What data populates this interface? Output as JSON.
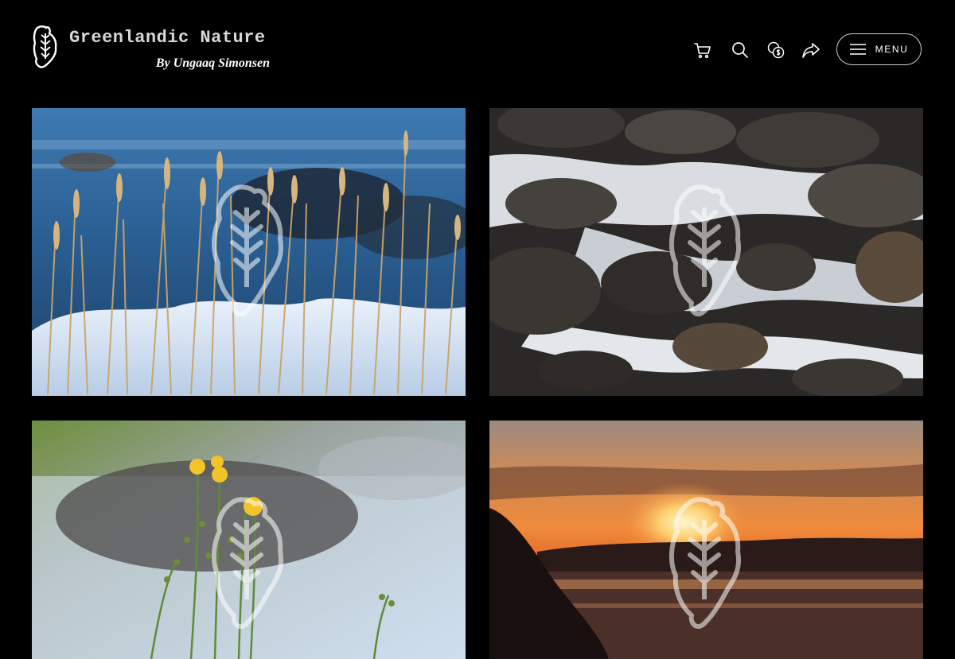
{
  "brand": {
    "title": "Greenlandic Nature",
    "subtitle": "By Ungaaq Simonsen",
    "logo_icon": "greenland-leaf-logo-icon"
  },
  "header": {
    "icons": [
      "cart-icon",
      "search-icon",
      "currency-icon",
      "share-icon"
    ],
    "menu_label": "MENU"
  },
  "gallery": {
    "photos": [
      {
        "subject": "frosted-grass-snow",
        "watermark": "greenland-leaf-watermark"
      },
      {
        "subject": "icy-rocks-stream",
        "watermark": "greenland-leaf-watermark"
      },
      {
        "subject": "yellow-wildflowers-river",
        "watermark": "greenland-leaf-watermark"
      },
      {
        "subject": "sunset-over-fjord",
        "watermark": "greenland-leaf-watermark"
      }
    ]
  },
  "colors": {
    "background": "#000000",
    "text": "#ffffff",
    "title": "#d8d8d8"
  }
}
